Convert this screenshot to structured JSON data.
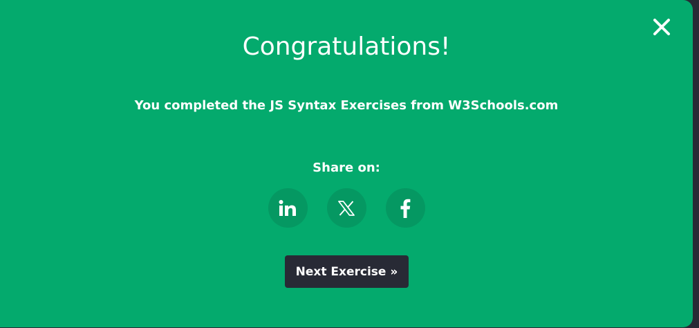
{
  "modal": {
    "title": "Congratulations!",
    "subtitle": "You completed the JS Syntax Exercises from W3Schools.com",
    "share_label": "Share on:",
    "share_buttons": [
      {
        "icon": "linkedin-icon"
      },
      {
        "icon": "x-icon"
      },
      {
        "icon": "facebook-icon"
      }
    ],
    "next_label": "Next Exercise »",
    "close_icon": "close-icon"
  },
  "colors": {
    "modal_background": "#04aa6d",
    "share_button_background": "#059862",
    "next_button_background": "#282a35",
    "page_background": "#282a35",
    "text": "#ffffff"
  }
}
